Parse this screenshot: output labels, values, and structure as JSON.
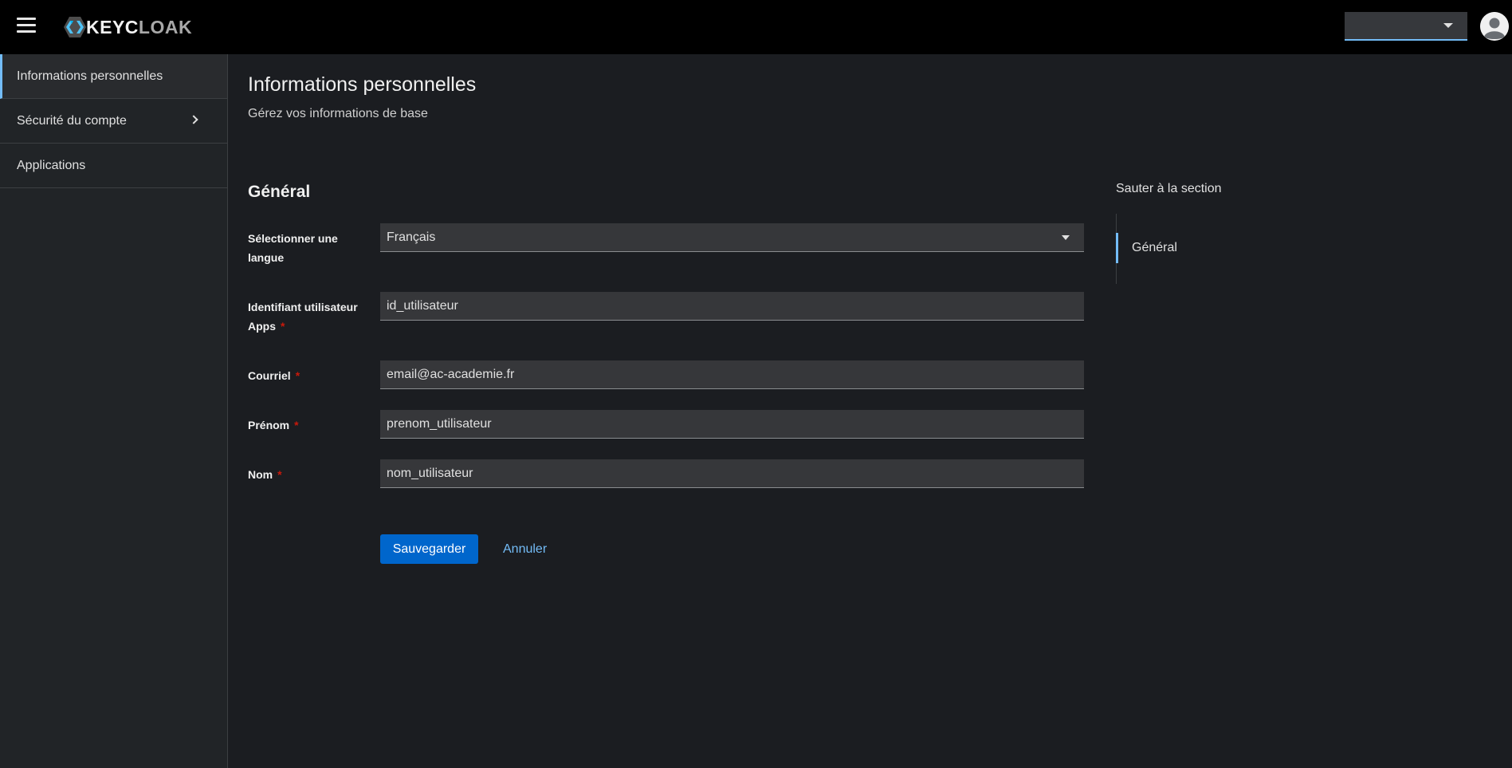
{
  "header": {
    "menu_icon": "hamburger-icon",
    "logo_text_light": "KEYC",
    "logo_text_dim": "LOAK",
    "select_value": "",
    "avatar_icon": "user-avatar-icon"
  },
  "sidebar": {
    "items": [
      {
        "label": "Informations personnelles",
        "active": true
      },
      {
        "label": "Sécurité du compte",
        "expandable": true
      },
      {
        "label": "Applications"
      }
    ]
  },
  "page": {
    "title": "Informations personnelles",
    "description": "Gérez vos informations de base"
  },
  "form": {
    "section_title": "Général",
    "fields": [
      {
        "label": "Sélectionner une langue",
        "value": "Français",
        "required": false,
        "type": "select"
      },
      {
        "label": "Identifiant utilisateur Apps",
        "value": "id_utilisateur",
        "required": true
      },
      {
        "label": "Courriel",
        "value": "email@ac-academie.fr",
        "required": true
      },
      {
        "label": "Prénom",
        "value": "prenom_utilisateur",
        "required": true
      },
      {
        "label": "Nom",
        "value": "nom_utilisateur",
        "required": true
      }
    ],
    "required_mark": "*",
    "save_label": "Sauvegarder",
    "cancel_label": "Annuler"
  },
  "jump_links": {
    "title": "Sauter à la section",
    "items": [
      "Général"
    ]
  },
  "colors": {
    "accent": "#73bcf7",
    "primary_button": "#0066cc",
    "required": "#c9190b",
    "background": "#1b1d21"
  }
}
